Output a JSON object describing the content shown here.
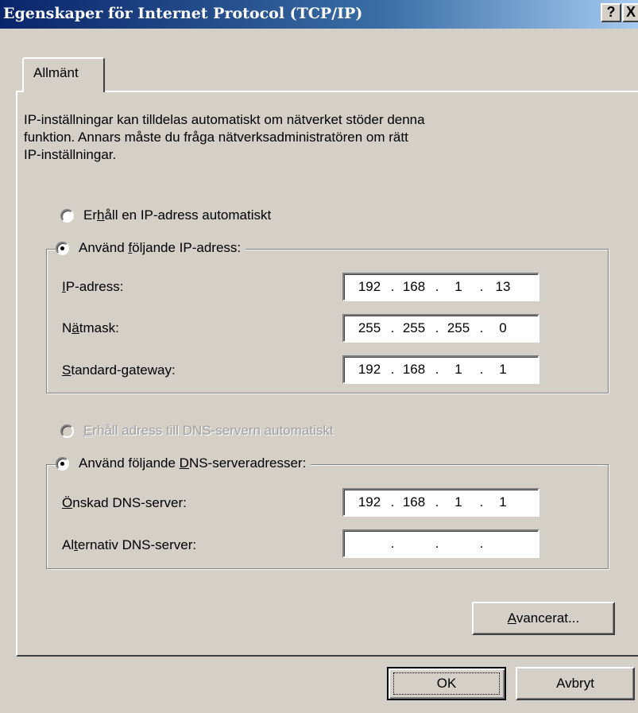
{
  "window": {
    "title": "Egenskaper för Internet Protocol (TCP/IP)",
    "help_label": "?",
    "close_label": "X"
  },
  "tab": {
    "label": "Allmänt"
  },
  "description": {
    "line1": "IP-inställningar kan tilldelas automatiskt om nätverket stöder denna",
    "line2": "funktion. Annars måste du fråga nätverksadministratören om rätt",
    "line3": "IP-inställningar."
  },
  "ip_auto": {
    "pre": "Er",
    "key": "h",
    "post": "åll en IP-adress automatiskt",
    "checked": false
  },
  "ip_manual": {
    "pre": "Använd ",
    "key": "f",
    "post": "öljande IP-adress:",
    "checked": true
  },
  "ip_fields": [
    {
      "pre": "",
      "key": "I",
      "post": "P-adress:",
      "octets": [
        "192",
        "168",
        "1",
        "13"
      ]
    },
    {
      "pre": "N",
      "key": "ä",
      "post": "tmask:",
      "octets": [
        "255",
        "255",
        "255",
        "0"
      ]
    },
    {
      "pre": "",
      "key": "S",
      "post": "tandard-gateway:",
      "octets": [
        "192",
        "168",
        "1",
        "1"
      ]
    }
  ],
  "dns_auto": {
    "pre": "",
    "key": "E",
    "post": "rhåll adress till DNS-servern automatiskt",
    "checked": false,
    "disabled": true
  },
  "dns_manual": {
    "pre": "Använd följande ",
    "key": "D",
    "post": "NS-serveradresser:",
    "checked": true
  },
  "dns_fields": [
    {
      "pre": "",
      "key": "Ö",
      "post": "nskad DNS-server:",
      "octets": [
        "192",
        "168",
        "1",
        "1"
      ]
    },
    {
      "pre": "Al",
      "key": "t",
      "post": "ernativ DNS-server:",
      "octets": [
        "",
        "",
        "",
        ""
      ]
    }
  ],
  "advanced_button": {
    "pre": "",
    "key": "A",
    "post": "vancerat..."
  },
  "ok_button": {
    "label": "OK"
  },
  "cancel_button": {
    "label": "Avbryt"
  },
  "colors": {
    "title_bar_start": "#0a246a",
    "title_bar_end": "#a6caf0",
    "face": "#d4d0c8"
  }
}
